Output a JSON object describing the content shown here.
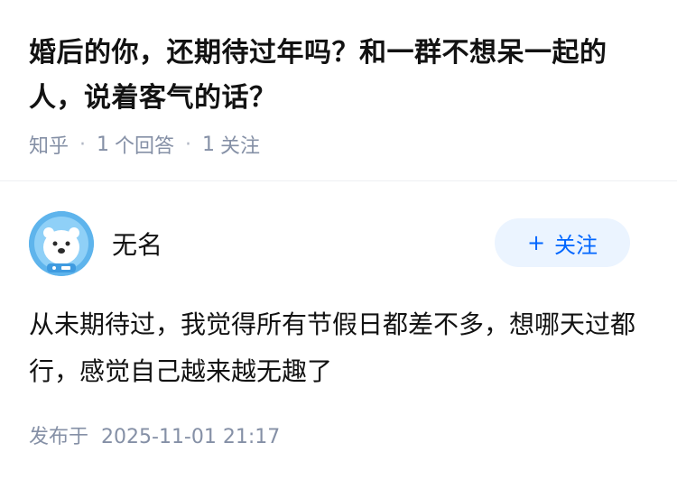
{
  "question": {
    "title": "婚后的你，还期待过年吗？和一群不想呆一起的人，说着客气的话？"
  },
  "meta": {
    "source": "知乎",
    "answers_count": "1",
    "answers_label": "个回答",
    "followers_count": "1",
    "followers_label": "关注"
  },
  "author": {
    "name": "无名",
    "avatar_icon": "polar-bear-avatar-icon",
    "follow_plus": "+",
    "follow_label": "关注"
  },
  "answer": {
    "text": "从未期待过，我觉得所有节假日都差不多，想哪天过都行，感觉自己越来越无趣了",
    "published_label": "发布于",
    "published_date": "2025-11-01 21:17"
  },
  "colors": {
    "accent": "#0066ff",
    "follow_bg": "#ebf4ff",
    "meta_gray": "#8590a6",
    "avatar_bg": "#5eb4ec"
  }
}
